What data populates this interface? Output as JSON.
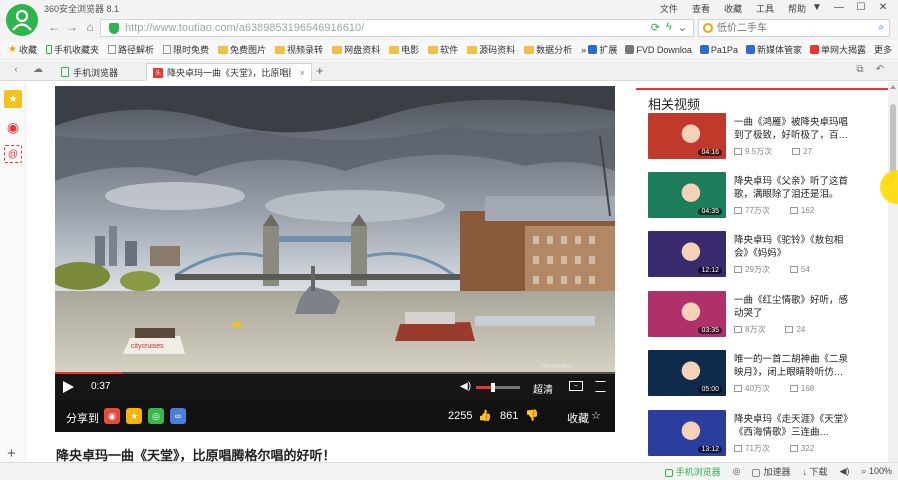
{
  "window": {
    "title": "360安全浏览器 8.1",
    "menu": [
      "文件",
      "查看",
      "收藏",
      "工具",
      "帮助"
    ],
    "controls": [
      "▼",
      "—",
      "☐",
      "✕"
    ]
  },
  "address": {
    "url": "http://www.toutiao.com/a6389853196546916610/",
    "search_placeholder": "低价二手车"
  },
  "bookmarks": {
    "items": [
      {
        "label": "收藏",
        "icon": "star"
      },
      {
        "label": "手机收藏夹",
        "icon": "phone"
      },
      {
        "label": "路径解析",
        "icon": "page"
      },
      {
        "label": "限时免费",
        "icon": "page"
      },
      {
        "label": "免费图片",
        "icon": "folder"
      },
      {
        "label": "视频录转",
        "icon": "folder"
      },
      {
        "label": "网盘资料",
        "icon": "folder"
      },
      {
        "label": "电影",
        "icon": "folder"
      },
      {
        "label": "软件",
        "icon": "folder"
      },
      {
        "label": "源码资料",
        "icon": "folder"
      },
      {
        "label": "数据分析",
        "icon": "folder"
      }
    ],
    "more_chevron": "»",
    "right": [
      {
        "label": "扩展",
        "icon": "grid"
      },
      {
        "label": "FVD Downloa",
        "icon": "grey"
      },
      {
        "label": "Pa1Pa",
        "icon": "blue"
      },
      {
        "label": "新媒体管家",
        "icon": "blue"
      },
      {
        "label": "单网大揭露",
        "icon": "red"
      },
      {
        "label": "更多",
        "icon": "more"
      }
    ]
  },
  "tabs": [
    {
      "label": "手机浏览器",
      "active": false
    },
    {
      "label": "降央卓玛一曲《天堂》，比原唱腾格尔",
      "active": true
    }
  ],
  "video": {
    "current_time": "0:37",
    "progress_fraction": 0.12,
    "volume_fraction": 0.35,
    "quality_label": "超清",
    "share_label": "分享到",
    "likes": "2255",
    "dislikes": "861",
    "collect_label": "收藏",
    "watermark": "Nextvideo",
    "boat_text": "citycruises",
    "title": "降央卓玛一曲《天堂》，比原唱腾格尔唱的好听！"
  },
  "related": {
    "heading": "相关视频",
    "items": [
      {
        "title": "一曲《鸿雁》被降央卓玛唱到了极致，好听极了，百…",
        "duration": "04:16",
        "views": "9.5万次",
        "comments": "27",
        "color": "#c0392b"
      },
      {
        "title": "降央卓玛《父亲》听了这首歌，满眼除了泪还是泪。",
        "duration": "04:35",
        "views": "77万次",
        "comments": "162",
        "color": "#1e7d5a"
      },
      {
        "title": "降央卓玛《驼铃》《敖包相会》《妈妈》",
        "duration": "12:12",
        "views": "29万次",
        "comments": "54",
        "color": "#3a2a6e"
      },
      {
        "title": "一曲《红尘情歌》好听，感动哭了",
        "duration": "03:35",
        "views": "8万次",
        "comments": "24",
        "color": "#b0306a"
      },
      {
        "title": "唯一的一首二胡神曲《二泉映月》，闭上眼睛聆听仿…",
        "duration": "05:00",
        "views": "40万次",
        "comments": "168",
        "color": "#0f2a4a"
      },
      {
        "title": "降央卓玛《走天涯》《天堂》《西海情歌》三连曲…",
        "duration": "13:12",
        "views": "71万次",
        "comments": "322",
        "color": "#2b3e9e"
      }
    ]
  },
  "statusbar": {
    "items": [
      "手机浏览器",
      "加速器",
      "下载",
      "100%"
    ]
  }
}
